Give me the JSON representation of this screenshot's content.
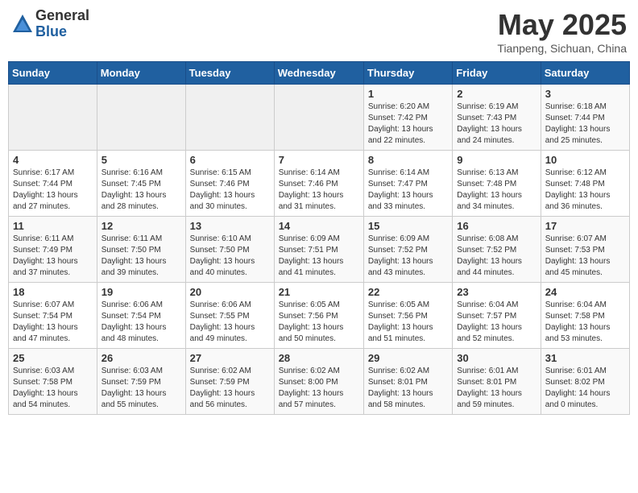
{
  "logo": {
    "general": "General",
    "blue": "Blue"
  },
  "title": "May 2025",
  "subtitle": "Tianpeng, Sichuan, China",
  "days_header": [
    "Sunday",
    "Monday",
    "Tuesday",
    "Wednesday",
    "Thursday",
    "Friday",
    "Saturday"
  ],
  "weeks": [
    [
      {
        "day": "",
        "info": ""
      },
      {
        "day": "",
        "info": ""
      },
      {
        "day": "",
        "info": ""
      },
      {
        "day": "",
        "info": ""
      },
      {
        "day": "1",
        "info": "Sunrise: 6:20 AM\nSunset: 7:42 PM\nDaylight: 13 hours\nand 22 minutes."
      },
      {
        "day": "2",
        "info": "Sunrise: 6:19 AM\nSunset: 7:43 PM\nDaylight: 13 hours\nand 24 minutes."
      },
      {
        "day": "3",
        "info": "Sunrise: 6:18 AM\nSunset: 7:44 PM\nDaylight: 13 hours\nand 25 minutes."
      }
    ],
    [
      {
        "day": "4",
        "info": "Sunrise: 6:17 AM\nSunset: 7:44 PM\nDaylight: 13 hours\nand 27 minutes."
      },
      {
        "day": "5",
        "info": "Sunrise: 6:16 AM\nSunset: 7:45 PM\nDaylight: 13 hours\nand 28 minutes."
      },
      {
        "day": "6",
        "info": "Sunrise: 6:15 AM\nSunset: 7:46 PM\nDaylight: 13 hours\nand 30 minutes."
      },
      {
        "day": "7",
        "info": "Sunrise: 6:14 AM\nSunset: 7:46 PM\nDaylight: 13 hours\nand 31 minutes."
      },
      {
        "day": "8",
        "info": "Sunrise: 6:14 AM\nSunset: 7:47 PM\nDaylight: 13 hours\nand 33 minutes."
      },
      {
        "day": "9",
        "info": "Sunrise: 6:13 AM\nSunset: 7:48 PM\nDaylight: 13 hours\nand 34 minutes."
      },
      {
        "day": "10",
        "info": "Sunrise: 6:12 AM\nSunset: 7:48 PM\nDaylight: 13 hours\nand 36 minutes."
      }
    ],
    [
      {
        "day": "11",
        "info": "Sunrise: 6:11 AM\nSunset: 7:49 PM\nDaylight: 13 hours\nand 37 minutes."
      },
      {
        "day": "12",
        "info": "Sunrise: 6:11 AM\nSunset: 7:50 PM\nDaylight: 13 hours\nand 39 minutes."
      },
      {
        "day": "13",
        "info": "Sunrise: 6:10 AM\nSunset: 7:50 PM\nDaylight: 13 hours\nand 40 minutes."
      },
      {
        "day": "14",
        "info": "Sunrise: 6:09 AM\nSunset: 7:51 PM\nDaylight: 13 hours\nand 41 minutes."
      },
      {
        "day": "15",
        "info": "Sunrise: 6:09 AM\nSunset: 7:52 PM\nDaylight: 13 hours\nand 43 minutes."
      },
      {
        "day": "16",
        "info": "Sunrise: 6:08 AM\nSunset: 7:52 PM\nDaylight: 13 hours\nand 44 minutes."
      },
      {
        "day": "17",
        "info": "Sunrise: 6:07 AM\nSunset: 7:53 PM\nDaylight: 13 hours\nand 45 minutes."
      }
    ],
    [
      {
        "day": "18",
        "info": "Sunrise: 6:07 AM\nSunset: 7:54 PM\nDaylight: 13 hours\nand 47 minutes."
      },
      {
        "day": "19",
        "info": "Sunrise: 6:06 AM\nSunset: 7:54 PM\nDaylight: 13 hours\nand 48 minutes."
      },
      {
        "day": "20",
        "info": "Sunrise: 6:06 AM\nSunset: 7:55 PM\nDaylight: 13 hours\nand 49 minutes."
      },
      {
        "day": "21",
        "info": "Sunrise: 6:05 AM\nSunset: 7:56 PM\nDaylight: 13 hours\nand 50 minutes."
      },
      {
        "day": "22",
        "info": "Sunrise: 6:05 AM\nSunset: 7:56 PM\nDaylight: 13 hours\nand 51 minutes."
      },
      {
        "day": "23",
        "info": "Sunrise: 6:04 AM\nSunset: 7:57 PM\nDaylight: 13 hours\nand 52 minutes."
      },
      {
        "day": "24",
        "info": "Sunrise: 6:04 AM\nSunset: 7:58 PM\nDaylight: 13 hours\nand 53 minutes."
      }
    ],
    [
      {
        "day": "25",
        "info": "Sunrise: 6:03 AM\nSunset: 7:58 PM\nDaylight: 13 hours\nand 54 minutes."
      },
      {
        "day": "26",
        "info": "Sunrise: 6:03 AM\nSunset: 7:59 PM\nDaylight: 13 hours\nand 55 minutes."
      },
      {
        "day": "27",
        "info": "Sunrise: 6:02 AM\nSunset: 7:59 PM\nDaylight: 13 hours\nand 56 minutes."
      },
      {
        "day": "28",
        "info": "Sunrise: 6:02 AM\nSunset: 8:00 PM\nDaylight: 13 hours\nand 57 minutes."
      },
      {
        "day": "29",
        "info": "Sunrise: 6:02 AM\nSunset: 8:01 PM\nDaylight: 13 hours\nand 58 minutes."
      },
      {
        "day": "30",
        "info": "Sunrise: 6:01 AM\nSunset: 8:01 PM\nDaylight: 13 hours\nand 59 minutes."
      },
      {
        "day": "31",
        "info": "Sunrise: 6:01 AM\nSunset: 8:02 PM\nDaylight: 14 hours\nand 0 minutes."
      }
    ]
  ]
}
